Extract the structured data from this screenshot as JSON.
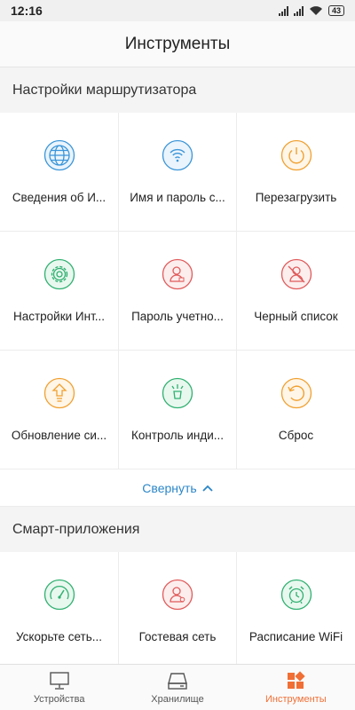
{
  "status_bar": {
    "time": "12:16",
    "battery": "43"
  },
  "header": {
    "title": "Инструменты"
  },
  "router_section": {
    "title": "Настройки маршрутизатора",
    "items": [
      {
        "label": "Сведения об И...",
        "icon": "globe-icon",
        "color": "#3a95d8"
      },
      {
        "label": "Имя и пароль с...",
        "icon": "wifi-icon",
        "color": "#3a95d8"
      },
      {
        "label": "Перезагрузить",
        "icon": "power-icon",
        "color": "#f0a030"
      },
      {
        "label": "Настройки Инт...",
        "icon": "gear-icon",
        "color": "#30b070"
      },
      {
        "label": "Пароль учетно...",
        "icon": "user-lock-icon",
        "color": "#e05a5a"
      },
      {
        "label": "Черный список",
        "icon": "user-blocked-icon",
        "color": "#e05a5a"
      },
      {
        "label": "Обновление си...",
        "icon": "upgrade-icon",
        "color": "#f0a030"
      },
      {
        "label": "Контроль инди...",
        "icon": "indicator-icon",
        "color": "#30b070"
      },
      {
        "label": "Сброс",
        "icon": "reset-icon",
        "color": "#f0a030"
      }
    ]
  },
  "collapse": {
    "label": "Свернуть"
  },
  "smart_section": {
    "title": "Смарт-приложения",
    "items": [
      {
        "label": "Ускорьте сеть...",
        "icon": "speedometer-icon",
        "color": "#30b070"
      },
      {
        "label": "Гостевая сеть",
        "icon": "guest-user-icon",
        "color": "#e05a5a"
      },
      {
        "label": "Расписание WiFi",
        "icon": "alarm-clock-icon",
        "color": "#30b070"
      }
    ]
  },
  "bottom_nav": {
    "devices": "Устройства",
    "storage": "Хранилище",
    "tools": "Инструменты",
    "active_color": "#f06f35"
  }
}
